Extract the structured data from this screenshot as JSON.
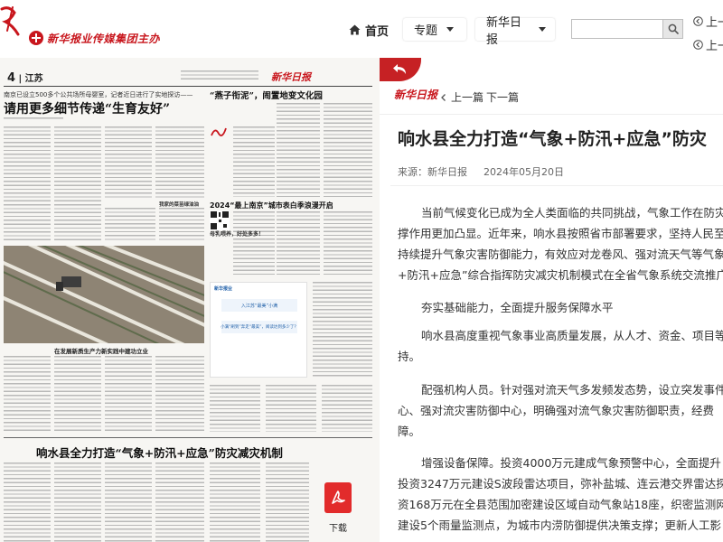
{
  "header": {
    "brand_logo_text": "新华报业传媒集团主办",
    "nav": {
      "home": "首页",
      "topic": "专题",
      "paper": "新华日报"
    },
    "search": {
      "value": "",
      "placeholder": ""
    },
    "pager": {
      "prev": "上一",
      "next": "上一"
    }
  },
  "newspaper": {
    "page_number": "4",
    "section": "江苏",
    "masthead": "新华日报",
    "kicker": "南京已设立500多个公共场所母婴室，记者近日进行了实地探访——",
    "headline": "请用更多细节传递“生育友好”",
    "side_headline": "“燕子衔泥”，闹置地变文化园",
    "side_headline2": "2024“最上南京”城市表白季浪漫开启",
    "mid_subhead": "母乳喂养，好处多多！",
    "photo_subhead": "在发展新质生产力新实践中建功立业",
    "column_subhead": "我家的菜苗绿油油",
    "ad_title": "新华报业",
    "ad_line1": "入江苏“最美”小满",
    "ad_line2": "小满“刷到”奔走“最美”，阅读达到多少了？",
    "headline2": "响水县全力打造“气象+防汛+应急”防灾减灾机制"
  },
  "article": {
    "logo": "新华日报",
    "prev": "上一篇",
    "next": "下一篇",
    "title": "响水县全力打造“气象+防汛+应急”防灾",
    "source_label": "来源：新华日报",
    "date": "2024年05月20日",
    "paragraphs": [
      "当前气候变化已成为全人类面临的共同挑战，气象工作在防灾",
      "撑作用更加凸显。近年来，响水县按照省市部署要求，坚持人民至",
      "持续提升气象灾害防御能力，有效应对龙卷风、强对流天气等气象",
      "+防汛+应急”综合指挥防灾减灾机制模式在全省气象系统交流推广",
      "夯实基础能力，全面提升服务保障水平",
      "响水县高度重视气象事业高质量发展，从人才、资金、项目等",
      "持。",
      "配强机构人员。针对强对流天气多发频发态势，设立突发事件",
      "心、强对流灾害防御中心，明确强对流气象灾害防御职责，经费",
      "障。",
      "增强设备保障。投资4000万元建成气象预警中心，全面提升",
      "投资3247万元建设S波段雷达项目，弥补盐城、连云港交界雷达探",
      "资168万元在全县范围加密建设区域自动气象站18座，织密监测网",
      "建设5个雨量监测点，为城市内涝防御提供决策支撑；更新人工影"
    ]
  },
  "download": {
    "label": "下载"
  },
  "colors": {
    "brand_red": "#c8161d",
    "button_red": "#c62124",
    "pdf_red": "#e22b2b"
  }
}
